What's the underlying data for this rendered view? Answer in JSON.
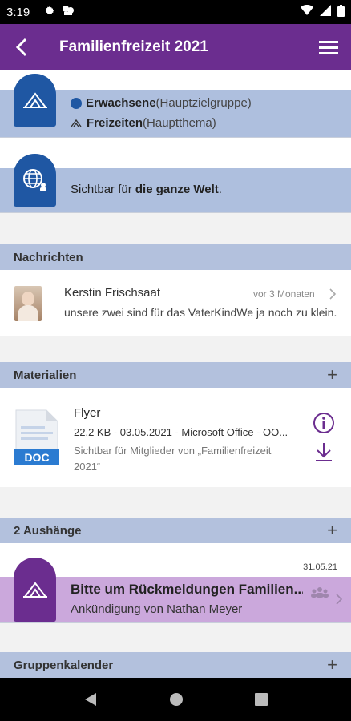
{
  "status": {
    "time": "3:19"
  },
  "appbar": {
    "title": "Familienfreizeit 2021"
  },
  "topics": {
    "audience_label": "Erwachsene",
    "audience_suffix": " (Hauptzielgruppe)",
    "theme_label": "Freizeiten",
    "theme_suffix": " (Hauptthema)"
  },
  "visibility": {
    "prefix": "Sichtbar für ",
    "bold": "die ganze Welt",
    "suffix": "."
  },
  "news": {
    "header": "Nachrichten",
    "author": "Kerstin Frischsaat",
    "time": "vor 3 Monaten",
    "preview": "unsere zwei sind für das VaterKindWe ja noch zu klein..."
  },
  "materials": {
    "header": "Materialien",
    "add": "+",
    "file": {
      "type_label": "DOC",
      "name": "Flyer",
      "meta": "22,2 KB - 03.05.2021 - Microsoft Office - OO...",
      "visibility_line1": "Sichtbar für Mitglieder von „Familienfreizeit",
      "visibility_line2": "2021“"
    }
  },
  "notices": {
    "header": "2 Aushänge",
    "add": "+",
    "item": {
      "date": "31.05.21",
      "title": "Bitte um Rückmeldungen Familien...",
      "subtitle": "Ankündigung von Nathan Meyer"
    }
  },
  "calendar": {
    "header": "Gruppenkalender",
    "add": "+"
  },
  "colors": {
    "brand": "#6b2d8f",
    "topic_blue": "#1f57a3",
    "card_bg": "#aebfde"
  }
}
